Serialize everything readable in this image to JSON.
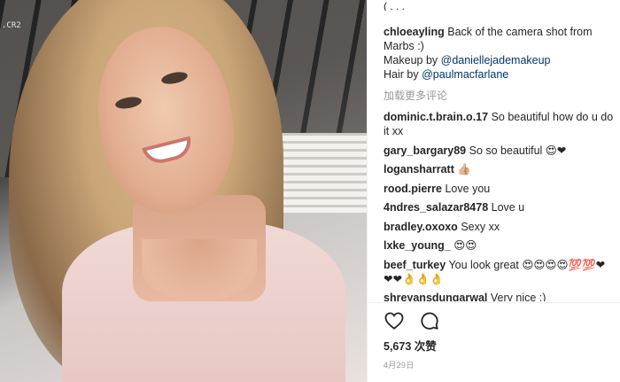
{
  "photo": {
    "corner_label": ".CR2"
  },
  "header": {
    "cut_text": "( . . ."
  },
  "caption": {
    "username": "chloeayling",
    "line1": "Back of the camera shot from Marbs :)",
    "makeup_prefix": "Makeup by ",
    "makeup_mention": "@daniellejademakeup",
    "hair_prefix": "Hair by ",
    "hair_mention": "@paulmacfarlane"
  },
  "load_more": "加载更多评论",
  "comments": [
    {
      "user": "dominic.t.brain.o.17",
      "text": "So beautiful how do u do it xx"
    },
    {
      "user": "gary_bargary89",
      "text": "So so beautiful 😍❤"
    },
    {
      "user": "logansharratt",
      "text": "👍🏼"
    },
    {
      "user": "rood.pierre",
      "text": "Love you"
    },
    {
      "user": "4ndres_salazar8478",
      "text": "Love u"
    },
    {
      "user": "bradley.oxoxo",
      "text": "Sexy xx"
    },
    {
      "user": "lxke_young_",
      "text": "😍😍"
    },
    {
      "user": "beef_turkey",
      "text": "You look great 😍😍😍😍💯💯❤ ❤❤👌👌👌"
    },
    {
      "user": "shreyansdungarwal",
      "text": "Very nice :)"
    }
  ],
  "partial_comment": "......   ........  .......",
  "actions": {
    "like_icon": "heart-icon",
    "comment_icon": "comment-bubble-icon"
  },
  "likes": {
    "count": "5,673",
    "label": "次赞"
  },
  "date": "4月29日"
}
